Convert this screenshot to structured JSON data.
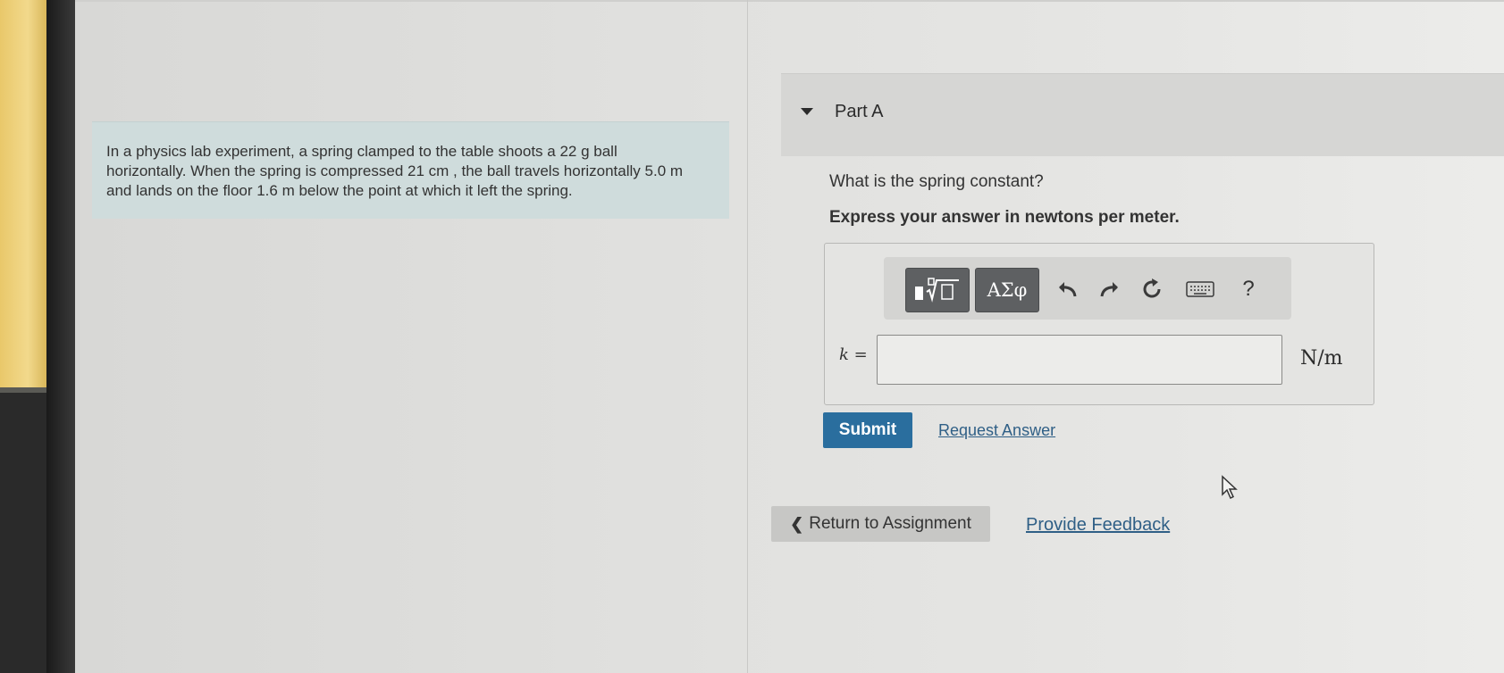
{
  "problem": {
    "text_line1": "In a physics lab experiment, a spring clamped to the table shoots a 22  g ball",
    "text_line2": "horizontally. When the spring is compressed 21  cm , the ball travels horizontally 5.0  m",
    "text_line3": "and lands on the floor 1.6  m below the point at which it left the spring."
  },
  "part": {
    "title": "Part A",
    "question": "What is the spring constant?",
    "instruction": "Express your answer in newtons per meter."
  },
  "toolbar": {
    "templates_icon": "templates-icon",
    "greek_label": "ΑΣφ",
    "undo_icon": "undo-icon",
    "redo_icon": "redo-icon",
    "reset_icon": "reset-icon",
    "keyboard_icon": "keyboard-icon",
    "help_label": "?"
  },
  "answer": {
    "variable_label": "k =",
    "value": "",
    "unit": "N/m"
  },
  "actions": {
    "submit_label": "Submit",
    "request_answer_label": "Request Answer",
    "return_label": "Return to Assignment",
    "feedback_label": "Provide Feedback"
  },
  "colors": {
    "submit_bg": "#2a6e9e",
    "link": "#2f5f86",
    "problem_bg": "#cfdcdc"
  }
}
